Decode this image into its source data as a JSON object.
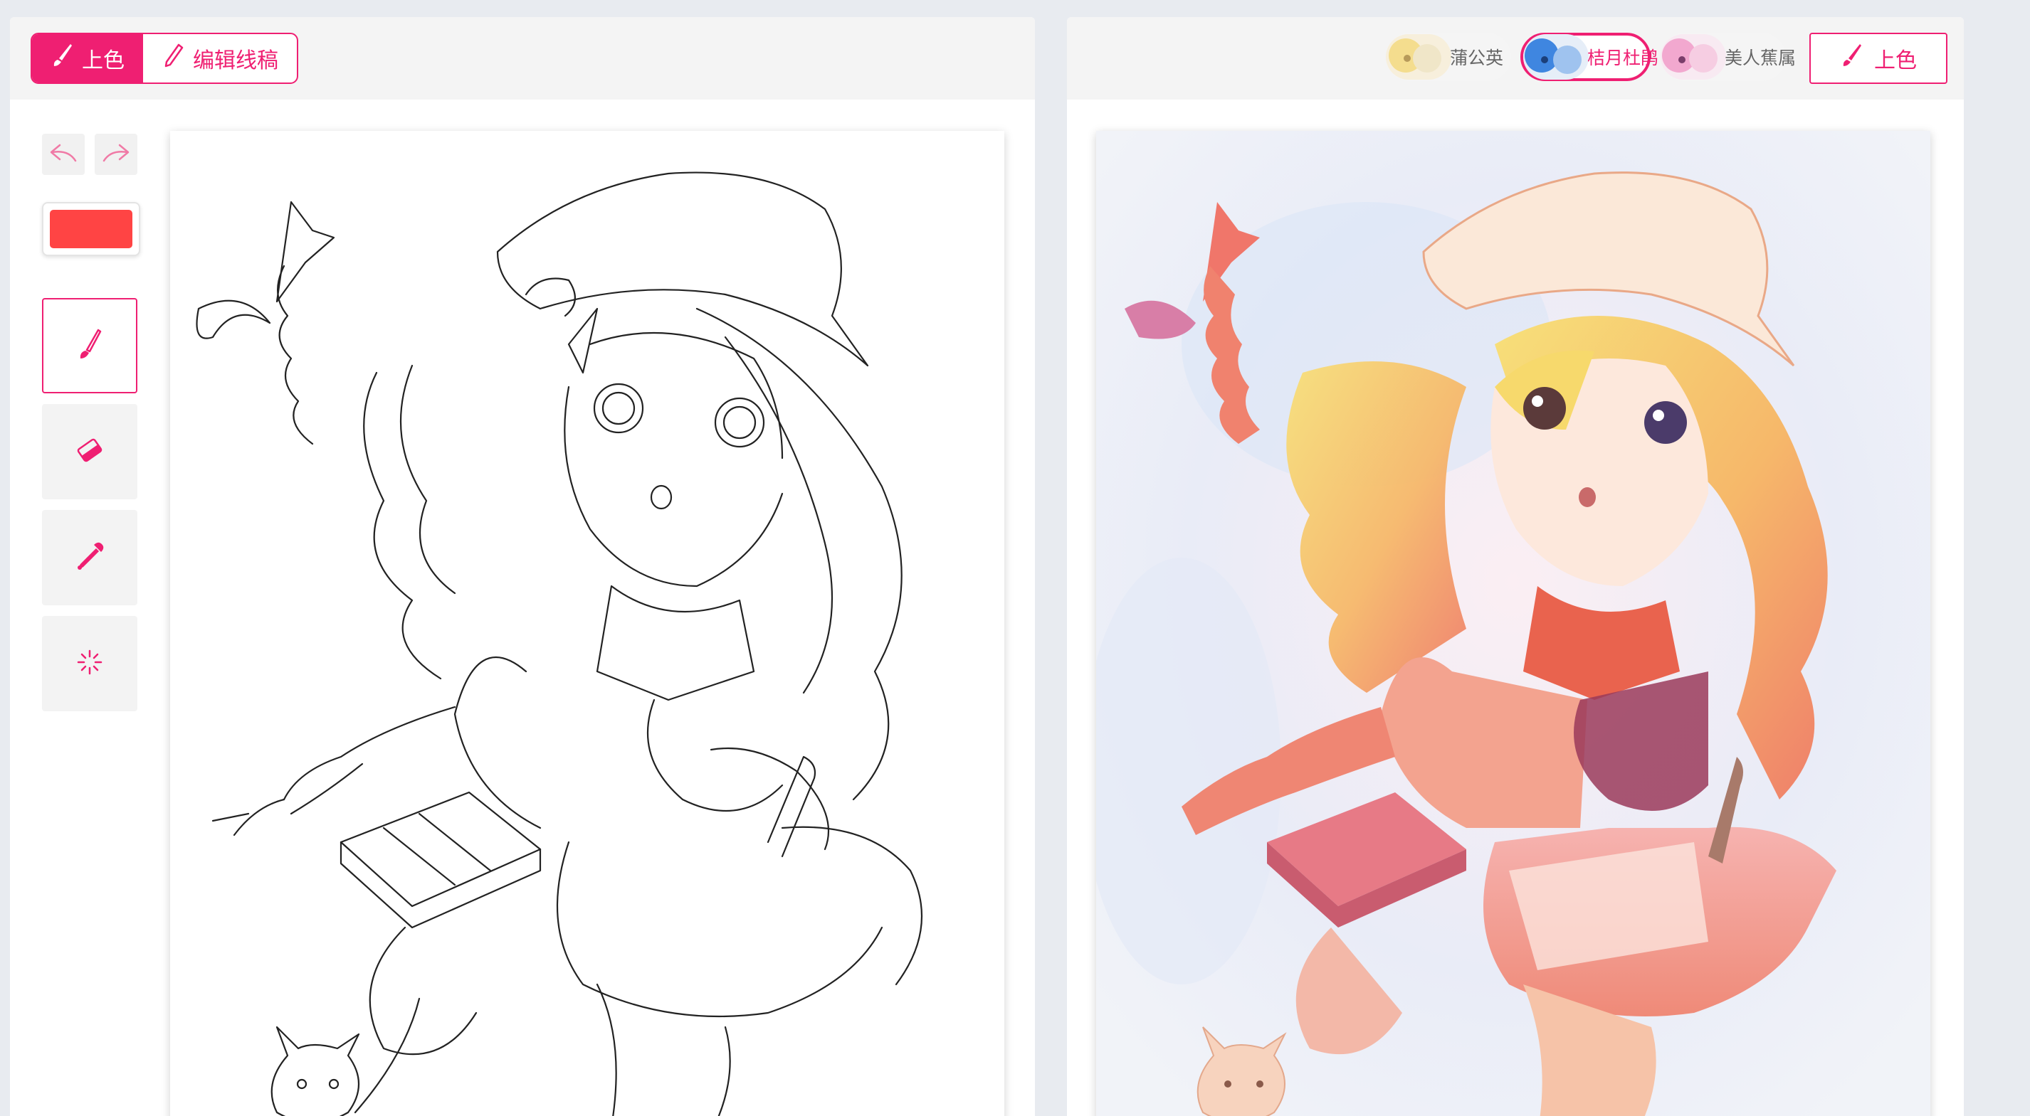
{
  "colors": {
    "accent": "#ef1f72",
    "current_color": "#ff4444"
  },
  "left_panel": {
    "mode_tabs": [
      {
        "label": "上色",
        "icon": "brush-icon",
        "active": true
      },
      {
        "label": "编辑线稿",
        "icon": "pencil-icon",
        "active": false
      }
    ],
    "toolbar": {
      "undo_icon": "undo-icon",
      "redo_icon": "redo-icon",
      "tools": [
        "brush-icon",
        "eraser-icon",
        "eyedropper-icon",
        "spinner-icon"
      ],
      "selected_tool": "brush-icon"
    }
  },
  "right_panel": {
    "style_presets": [
      {
        "label": "蒲公英",
        "active": false
      },
      {
        "label": "桔月杜鹃",
        "active": true
      },
      {
        "label": "美人蕉属",
        "active": false
      }
    ],
    "colorize_button": {
      "label": "上色",
      "icon": "brush-icon"
    }
  }
}
